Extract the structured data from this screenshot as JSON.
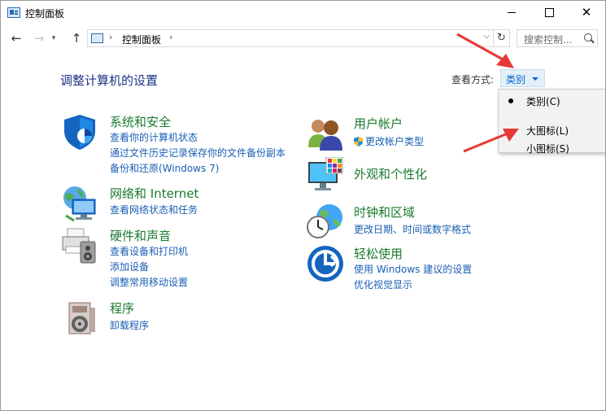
{
  "window": {
    "title": "控制面板",
    "controls": {
      "minimize": "minimize",
      "maximize": "maximize",
      "close": "✕"
    }
  },
  "nav": {
    "back": "←",
    "forward": "→",
    "up": "↑",
    "address_sep": "›",
    "address": "控制面板",
    "refresh": "↻",
    "search_placeholder": "搜索控制..."
  },
  "main": {
    "heading": "调整计算机的设置",
    "view_by_label": "查看方式:",
    "view_by_value": "类别"
  },
  "view_menu": {
    "items": [
      {
        "label": "类别(C)",
        "selected": true
      },
      {
        "label": "大图标(L)",
        "selected": false
      },
      {
        "label": "小图标(S)",
        "selected": false
      }
    ]
  },
  "categories": {
    "system": {
      "title": "系统和安全",
      "icon": "shield-icon",
      "links": [
        "查看你的计算机状态",
        "通过文件历史记录保存你的文件备份副本",
        "备份和还原(Windows 7)"
      ]
    },
    "network": {
      "title": "网络和 Internet",
      "icon": "network-globe-icon",
      "links": [
        "查看网络状态和任务"
      ]
    },
    "hardware": {
      "title": "硬件和声音",
      "icon": "printer-speaker-icon",
      "links": [
        "查看设备和打印机",
        "添加设备",
        "调整常用移动设置"
      ]
    },
    "programs": {
      "title": "程序",
      "icon": "programs-disc-icon",
      "links": [
        "卸载程序"
      ]
    },
    "users": {
      "title": "用户帐户",
      "icon": "users-icon",
      "links": [
        "更改帐户类型"
      ]
    },
    "appearance": {
      "title": "外观和个性化",
      "icon": "monitor-palette-icon",
      "links": []
    },
    "clock": {
      "title": "时钟和区域",
      "icon": "clock-globe-icon",
      "links": [
        "更改日期、时间或数字格式"
      ]
    },
    "ease": {
      "title": "轻松使用",
      "icon": "ease-of-access-icon",
      "links": [
        "使用 Windows 建议的设置",
        "优化视觉显示"
      ]
    }
  },
  "colors": {
    "heading": "#1e3287",
    "category_title": "#1a7a2e",
    "link": "#1a5fb4",
    "annotation_arrow": "#e53935",
    "selected_view_bg": "#e3eff9"
  }
}
